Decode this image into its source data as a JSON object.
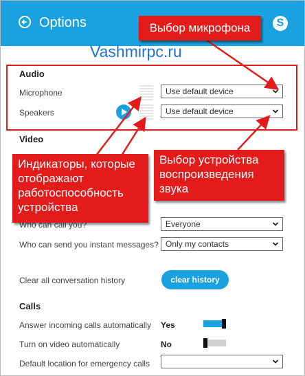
{
  "header": {
    "title": "Options",
    "bg_color": "#1aa2e0"
  },
  "watermark": "Vashmirpc.ru",
  "callouts": {
    "mic_select": "Выбор микрофона",
    "indicators": "Индикаторы, которые отображают работоспособность устройства",
    "output_select": "Выбор устройства воспроизведения звука",
    "color": "#e41b1b"
  },
  "audio": {
    "heading": "Audio",
    "microphone": {
      "label": "Microphone",
      "value": "Use default device"
    },
    "speakers": {
      "label": "Speakers",
      "value": "Use default device"
    }
  },
  "video": {
    "heading": "Video"
  },
  "privacy": {
    "who_can_call": {
      "label": "Who can call you?",
      "value": "Everyone"
    },
    "who_can_message": {
      "label": "Who can send you instant messages?",
      "value": "Only my contacts"
    }
  },
  "history": {
    "label": "Clear all conversation history",
    "button": "clear history"
  },
  "calls": {
    "heading": "Calls",
    "answer_auto": {
      "label": "Answer incoming calls automatically",
      "value": "Yes",
      "on": true
    },
    "video_auto": {
      "label": "Turn on video automatically",
      "value": "No",
      "on": false
    },
    "emergency": {
      "label": "Default location for emergency calls",
      "value": ""
    }
  }
}
